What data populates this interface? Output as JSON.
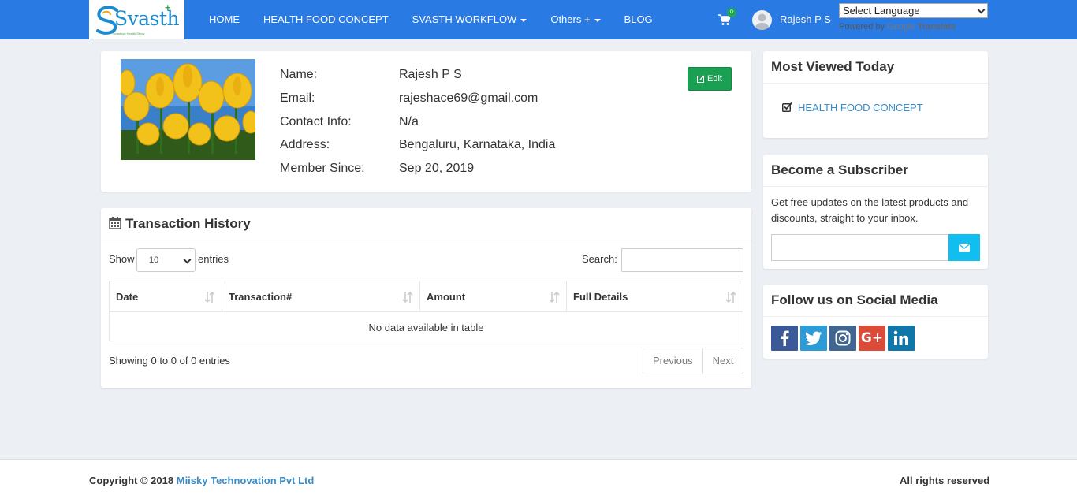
{
  "nav": {
    "logo_text": "Svasth",
    "logo_tagline": "Svasthya Health Study",
    "items": [
      {
        "label": "HOME"
      },
      {
        "label": "HEALTH FOOD CONCEPT"
      },
      {
        "label": "SVASTH WORKFLOW"
      },
      {
        "label": "Others +"
      },
      {
        "label": "BLOG"
      }
    ],
    "cart_count": "0",
    "user_name": "Rajesh P S",
    "language_select": "Select Language",
    "powered_by": "Powered by",
    "google": "Google",
    "translate": "Translate"
  },
  "profile": {
    "labels": {
      "name": "Name:",
      "email": "Email:",
      "contact": "Contact Info:",
      "address": "Address:",
      "member_since": "Member Since:"
    },
    "values": {
      "name": "Rajesh P S",
      "email": "rajeshace69@gmail.com",
      "contact": "N/a",
      "address": "Bengaluru, Karnataka, India",
      "member_since": "Sep 20, 2019"
    },
    "edit_label": "Edit"
  },
  "transactions": {
    "title": "Transaction History",
    "show_label": "Show",
    "entries_value": "10",
    "entries_label": "entries",
    "search_label": "Search:",
    "columns": [
      "Date",
      "Transaction#",
      "Amount",
      "Full Details"
    ],
    "empty_message": "No data available in table",
    "showing_text": "Showing 0 to 0 of 0 entries",
    "prev_label": "Previous",
    "next_label": "Next"
  },
  "sidebar": {
    "most_viewed_title": "Most Viewed Today",
    "most_viewed_link": "HEALTH FOOD CONCEPT",
    "subscriber_title": "Become a Subscriber",
    "subscriber_text": "Get free updates on the latest products and discounts, straight to your inbox.",
    "social_title": "Follow us on Social Media",
    "social": [
      {
        "name": "facebook",
        "glyph": "f",
        "color": "#3b5998"
      },
      {
        "name": "twitter",
        "glyph": "t",
        "color": "#2d9bd8"
      },
      {
        "name": "instagram",
        "glyph": "i",
        "color": "#3f6590"
      },
      {
        "name": "google-plus",
        "glyph": "G+",
        "color": "#dc4a38"
      },
      {
        "name": "linkedin",
        "glyph": "in",
        "color": "#0e76a8"
      }
    ]
  },
  "footer": {
    "copyright": "Copyright © 2018",
    "company": "Miisky Technovation Pvt Ltd",
    "rights": "All rights reserved"
  },
  "colors": {
    "navbar": "#2a7ae4",
    "edit_button": "#1aa052",
    "subscribe_button": "#10bef0",
    "link": "#3a8cc6"
  }
}
